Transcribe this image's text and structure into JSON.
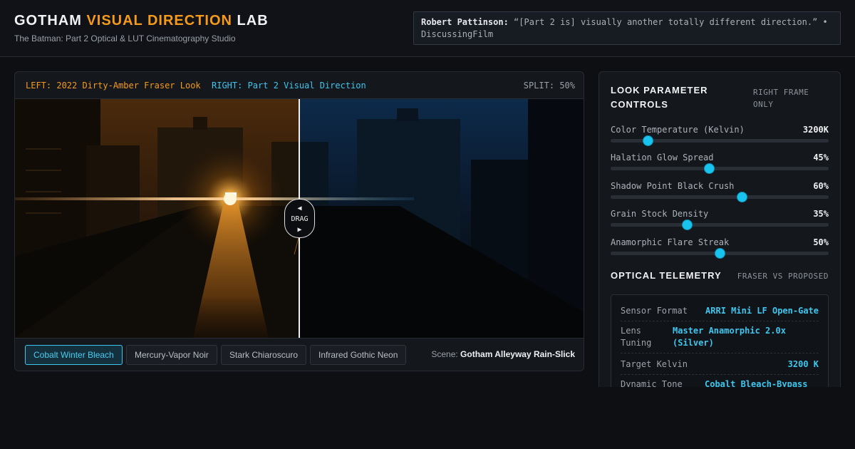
{
  "header": {
    "title_part1": "GOTHAM ",
    "title_accent": "VISUAL DIRECTION",
    "title_part2": " LAB",
    "subtitle": "The Batman: Part 2 Optical & LUT Cinematography Studio",
    "quote_speaker": "Robert Pattinson:",
    "quote_text": " “[Part 2 is] visually another totally different direction.” • DiscussingFilm"
  },
  "viewer": {
    "left_label": "LEFT: 2022 Dirty-Amber Fraser Look",
    "right_label": "RIGHT: Part 2 Visual Direction",
    "split_label": "SPLIT: 50%",
    "split_value": 50,
    "drag_left_arrow": "◀",
    "drag_label": "DRAG",
    "drag_right_arrow": "▶",
    "presets": [
      {
        "label": "Cobalt Winter Bleach",
        "active": true
      },
      {
        "label": "Mercury-Vapor Noir",
        "active": false
      },
      {
        "label": "Stark Chiaroscuro",
        "active": false
      },
      {
        "label": "Infrared Gothic Neon",
        "active": false
      }
    ],
    "scene_label": "Scene:",
    "scene_value": "Gotham Alleyway Rain-Slick"
  },
  "controls": {
    "title": "LOOK PARAMETER CONTROLS",
    "tag": "RIGHT FRAME ONLY",
    "sliders": [
      {
        "label": "Color Temperature (Kelvin)",
        "value": "3200K",
        "fraction": 0.17
      },
      {
        "label": "Halation Glow Spread",
        "value": "45%",
        "fraction": 0.45
      },
      {
        "label": "Shadow Point Black Crush",
        "value": "60%",
        "fraction": 0.6
      },
      {
        "label": "Grain Stock Density",
        "value": "35%",
        "fraction": 0.35
      },
      {
        "label": "Anamorphic Flare Streak",
        "value": "50%",
        "fraction": 0.5
      }
    ]
  },
  "telemetry": {
    "title": "OPTICAL TELEMETRY",
    "tag": "FRASER VS PROPOSED",
    "rows": [
      {
        "key": "Sensor Format",
        "value": "ARRI Mini LF Open-Gate"
      },
      {
        "key": "Lens Tuning",
        "value": "Master Anamorphic 2.0x (Silver)"
      },
      {
        "key": "Target Kelvin",
        "value": "3200 K"
      },
      {
        "key": "Dynamic Tone",
        "value": "Cobalt Bleach-Bypass"
      }
    ]
  },
  "colors": {
    "accent_amber": "#f59a1b",
    "accent_cyan": "#3ec6ee"
  }
}
